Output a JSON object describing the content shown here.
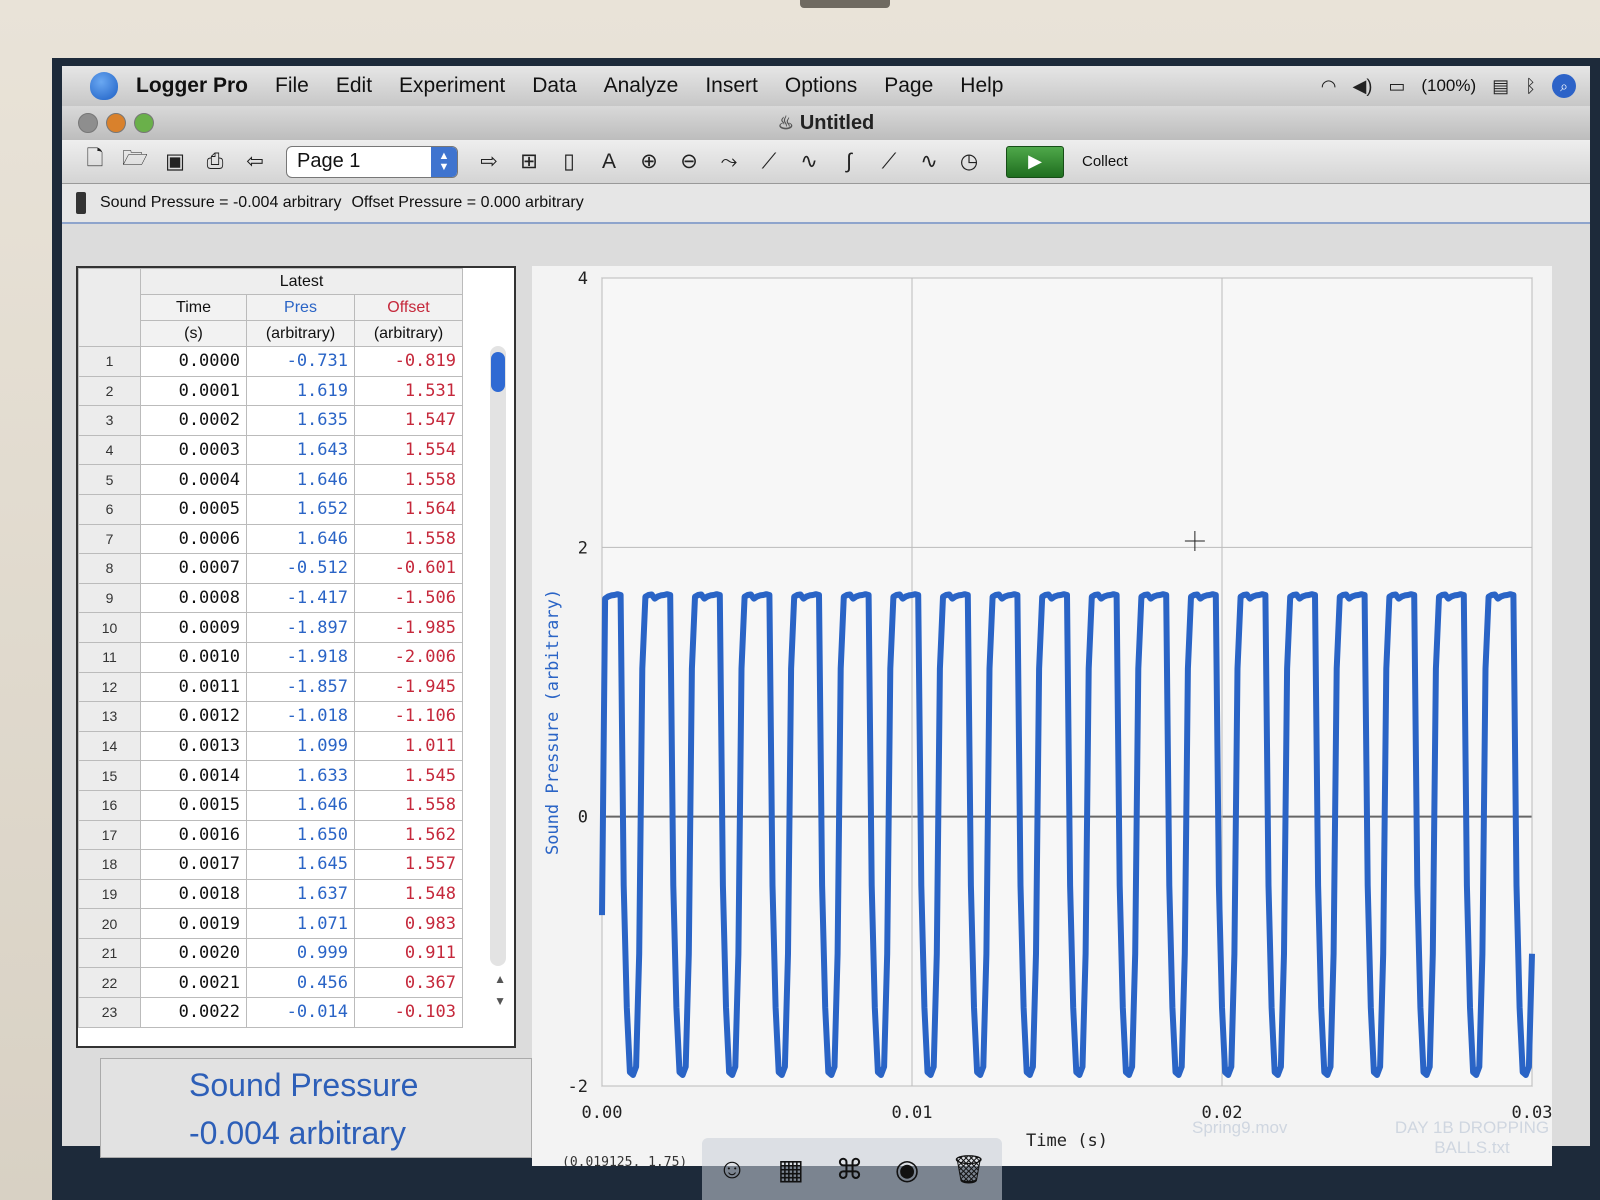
{
  "menubar": {
    "app_name": "Logger Pro",
    "items": [
      "File",
      "Edit",
      "Experiment",
      "Data",
      "Analyze",
      "Insert",
      "Options",
      "Page",
      "Help"
    ],
    "battery": "(100%)"
  },
  "window": {
    "title": "Untitled"
  },
  "toolbar": {
    "page_select": "Page 1",
    "collect_label": "Collect"
  },
  "sensor_bar": {
    "sound_pressure": "Sound Pressure = -0.004 arbitrary",
    "offset_pressure": "Offset Pressure = 0.000 arbitrary"
  },
  "table": {
    "dataset": "Latest",
    "columns": [
      {
        "name": "Time",
        "unit": "(s)"
      },
      {
        "name": "Pres",
        "unit": "(arbitrary)"
      },
      {
        "name": "Offset",
        "unit": "(arbitrary)"
      }
    ],
    "rows": [
      [
        "1",
        "0.0000",
        "-0.731",
        "-0.819"
      ],
      [
        "2",
        "0.0001",
        "1.619",
        "1.531"
      ],
      [
        "3",
        "0.0002",
        "1.635",
        "1.547"
      ],
      [
        "4",
        "0.0003",
        "1.643",
        "1.554"
      ],
      [
        "5",
        "0.0004",
        "1.646",
        "1.558"
      ],
      [
        "6",
        "0.0005",
        "1.652",
        "1.564"
      ],
      [
        "7",
        "0.0006",
        "1.646",
        "1.558"
      ],
      [
        "8",
        "0.0007",
        "-0.512",
        "-0.601"
      ],
      [
        "9",
        "0.0008",
        "-1.417",
        "-1.506"
      ],
      [
        "10",
        "0.0009",
        "-1.897",
        "-1.985"
      ],
      [
        "11",
        "0.0010",
        "-1.918",
        "-2.006"
      ],
      [
        "12",
        "0.0011",
        "-1.857",
        "-1.945"
      ],
      [
        "13",
        "0.0012",
        "-1.018",
        "-1.106"
      ],
      [
        "14",
        "0.0013",
        "1.099",
        "1.011"
      ],
      [
        "15",
        "0.0014",
        "1.633",
        "1.545"
      ],
      [
        "16",
        "0.0015",
        "1.646",
        "1.558"
      ],
      [
        "17",
        "0.0016",
        "1.650",
        "1.562"
      ],
      [
        "18",
        "0.0017",
        "1.645",
        "1.557"
      ],
      [
        "19",
        "0.0018",
        "1.637",
        "1.548"
      ],
      [
        "20",
        "0.0019",
        "1.071",
        "0.983"
      ],
      [
        "21",
        "0.0020",
        "0.999",
        "0.911"
      ],
      [
        "22",
        "0.0021",
        "0.456",
        "0.367"
      ],
      [
        "23",
        "0.0022",
        "-0.014",
        "-0.103"
      ]
    ]
  },
  "meter": {
    "title": "Sound Pressure",
    "value": "-0.004 arbitrary"
  },
  "graph": {
    "coords_readout": "(0.019125, 1.75)",
    "accent": "#2a64c6"
  },
  "chart_data": {
    "type": "line",
    "xlabel": "Time (s)",
    "ylabel": "Sound Pressure (arbitrary)",
    "xlim": [
      0,
      0.03
    ],
    "ylim": [
      -2,
      4
    ],
    "xticks": [
      "0.00",
      "0.01",
      "0.02",
      "0.03"
    ],
    "yticks": [
      "-2",
      "0",
      "2",
      "4"
    ],
    "grid": true,
    "series": [
      {
        "color": "#2a64c6",
        "x": [
          0.0,
          0.0001,
          0.0002,
          0.0003,
          0.0004,
          0.0005,
          0.0006,
          0.0007,
          0.0008,
          0.0009,
          0.001,
          0.0011,
          0.0012,
          0.0013,
          0.0014,
          0.0015,
          0.0016,
          0.0017,
          0.0018,
          0.0019,
          0.002,
          0.0021,
          0.0022,
          0.0023,
          0.0024,
          0.0025,
          0.0026,
          0.0027,
          0.0028,
          0.0029,
          0.003
        ],
        "y": [
          -0.731,
          1.619,
          1.635,
          1.643,
          1.646,
          1.652,
          1.646,
          -0.512,
          -1.417,
          -1.897,
          -1.918,
          -1.857,
          -1.018,
          1.099,
          1.633,
          1.646,
          1.65,
          1.645,
          1.637,
          1.071,
          0.999,
          0.456,
          -0.014,
          -0.6,
          -1.1,
          -1.4,
          -1.0,
          1.2,
          1.64,
          1.65,
          1.6
        ]
      }
    ],
    "cycle_period": 0.0016,
    "cycles": 19
  },
  "desktop": {
    "file1": "Spring9.mov",
    "file2": "DAY 1B DROPPING BALLS.txt"
  }
}
